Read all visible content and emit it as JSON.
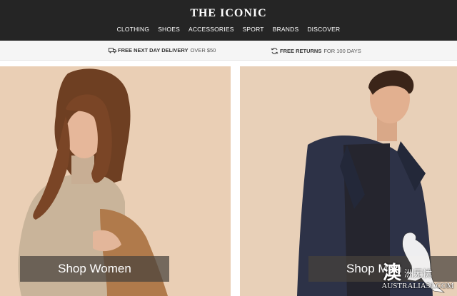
{
  "brand": {
    "logo": "THE ICONIC"
  },
  "nav": {
    "items": [
      {
        "label": "CLOTHING"
      },
      {
        "label": "SHOES"
      },
      {
        "label": "ACCESSORIES"
      },
      {
        "label": "SPORT"
      },
      {
        "label": "BRANDS"
      },
      {
        "label": "DISCOVER"
      }
    ]
  },
  "promo": {
    "delivery": {
      "bold": "FREE NEXT DAY DELIVERY",
      "rest": "OVER $50",
      "icon": "truck-icon"
    },
    "returns": {
      "bold": "FREE RETURNS",
      "rest": "FOR 100 DAYS",
      "icon": "refresh-icon"
    }
  },
  "hero": {
    "women": {
      "button_label": "Shop Women"
    },
    "men": {
      "button_label": "Shop Men"
    }
  },
  "watermark": {
    "latin": "AUSTRALIA51.COM",
    "cn": "洲无忧",
    "big": "澳",
    "icon": "kangaroo-icon"
  },
  "colors": {
    "header_bg": "#252525",
    "promo_bg": "#f5f5f5",
    "button_bg": "#46413c"
  }
}
